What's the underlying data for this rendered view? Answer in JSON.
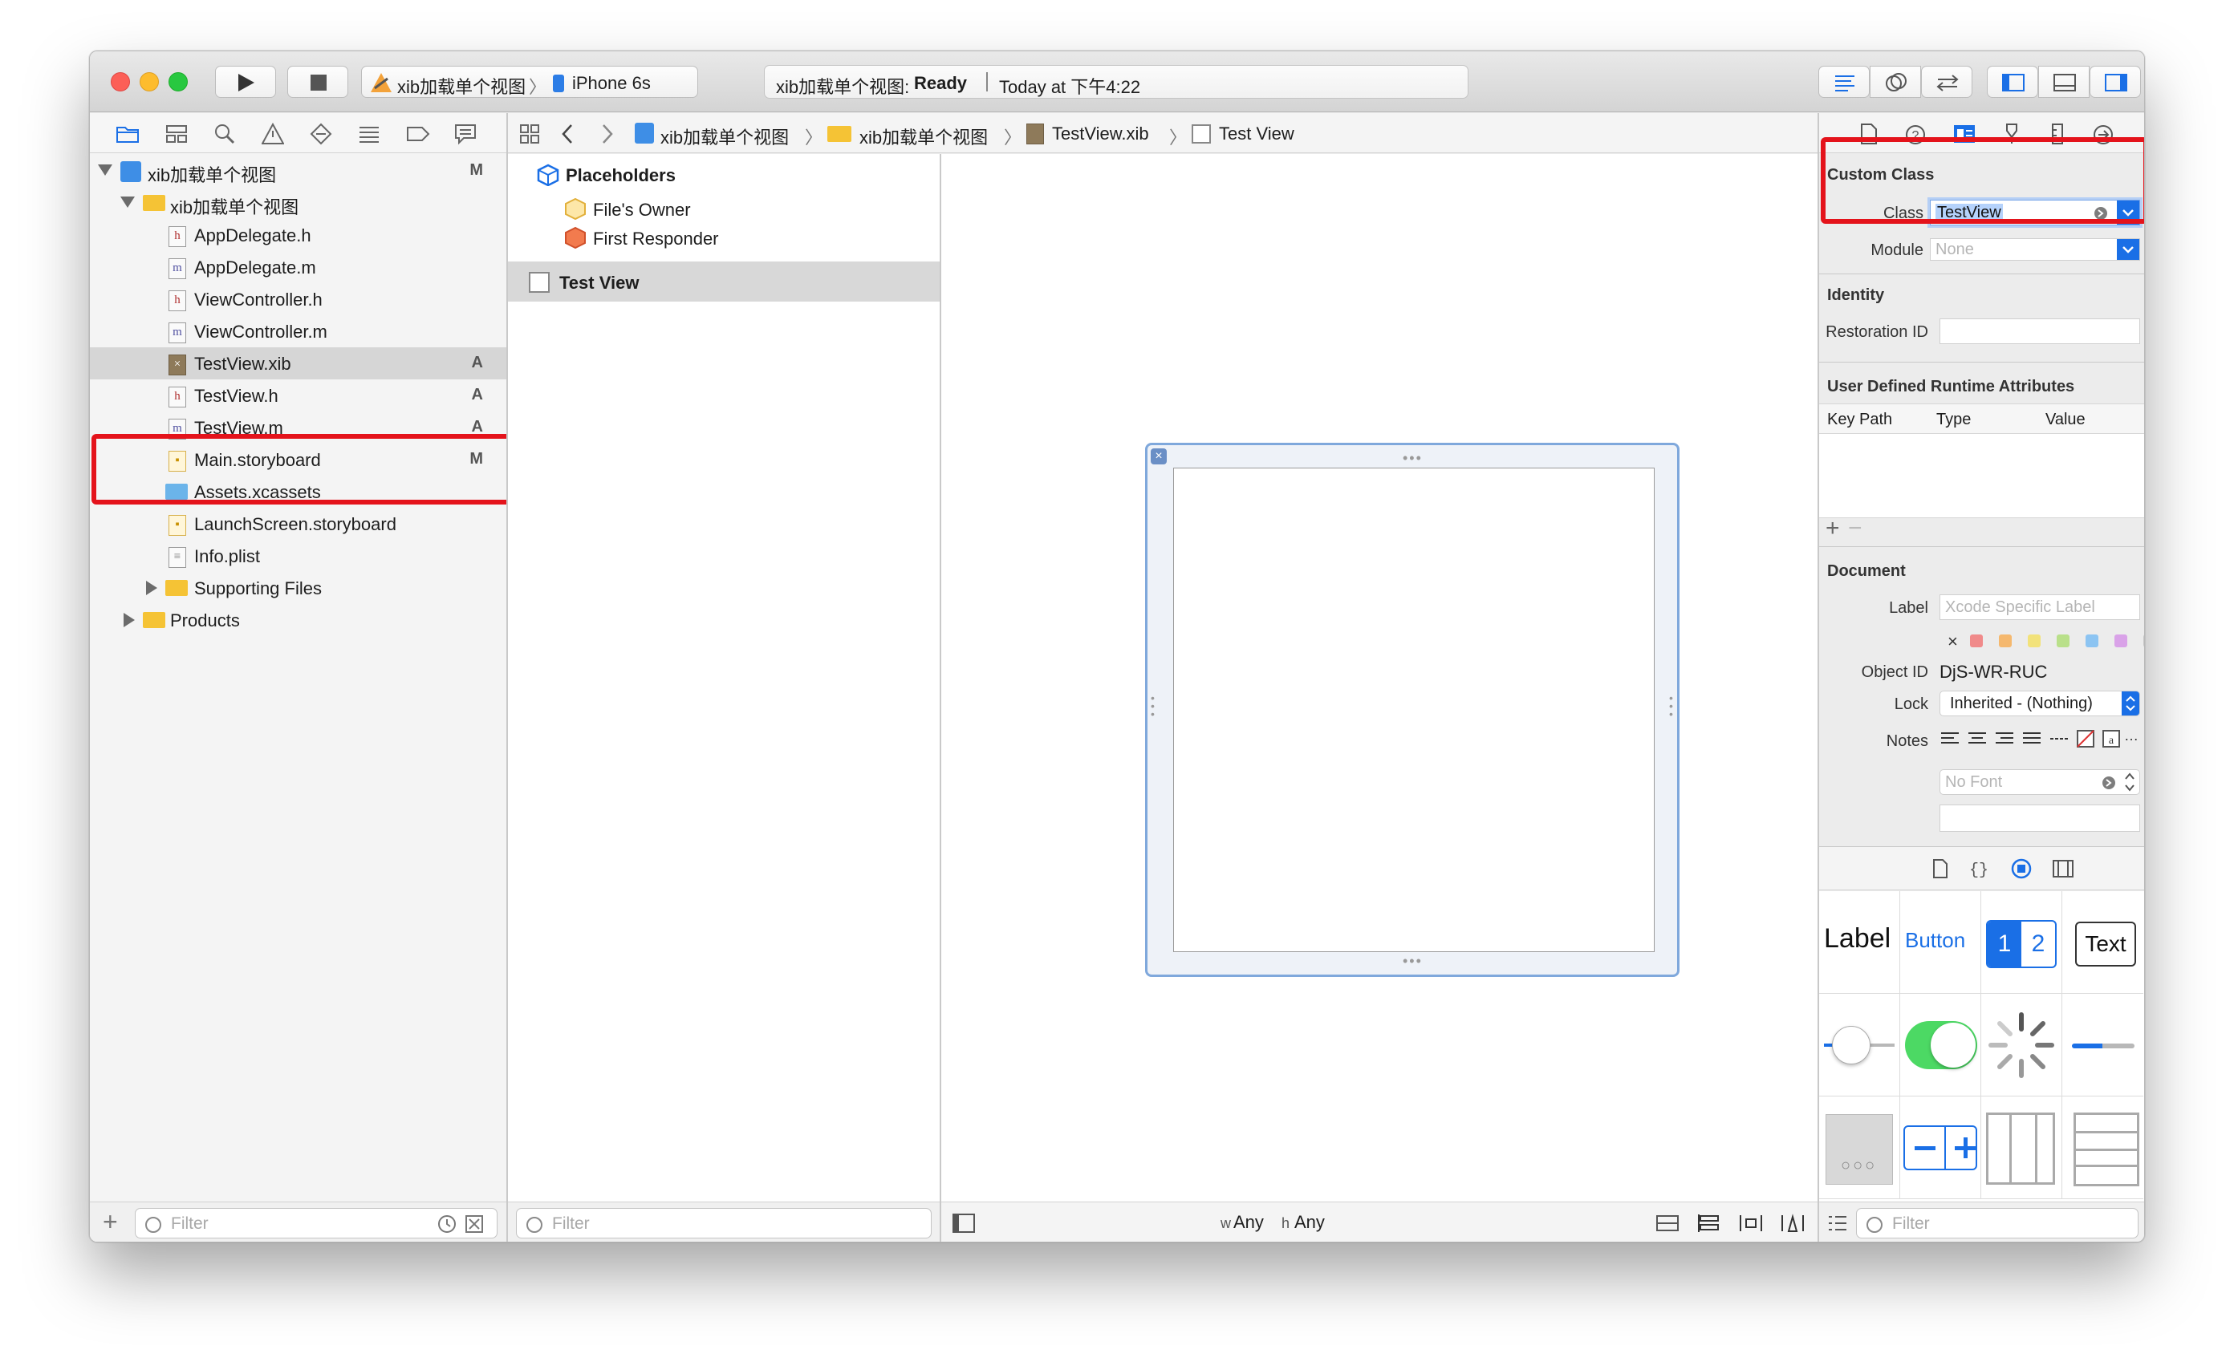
{
  "toolbar": {
    "scheme": "xib加载单个视图",
    "scheme_sep": "〉",
    "device": "iPhone 6s",
    "status_project": "xib加载单个视图:",
    "status_state": "Ready",
    "status_time": "Today at 下午4:22"
  },
  "navigator": {
    "filter_placeholder": "Filter",
    "items": [
      {
        "label": "xib加载单个视图",
        "badge": "M",
        "kind": "project"
      },
      {
        "label": "xib加载单个视图",
        "badge": "",
        "kind": "folder-open"
      },
      {
        "label": "AppDelegate.h",
        "badge": "",
        "kind": "h"
      },
      {
        "label": "AppDelegate.m",
        "badge": "",
        "kind": "m"
      },
      {
        "label": "ViewController.h",
        "badge": "",
        "kind": "h"
      },
      {
        "label": "ViewController.m",
        "badge": "",
        "kind": "m"
      },
      {
        "label": "TestView.xib",
        "badge": "A",
        "kind": "xib",
        "selected": true
      },
      {
        "label": "TestView.h",
        "badge": "A",
        "kind": "h"
      },
      {
        "label": "TestView.m",
        "badge": "A",
        "kind": "m"
      },
      {
        "label": "Main.storyboard",
        "badge": "M",
        "kind": "storyboard"
      },
      {
        "label": "Assets.xcassets",
        "badge": "",
        "kind": "assets"
      },
      {
        "label": "LaunchScreen.storyboard",
        "badge": "",
        "kind": "storyboard"
      },
      {
        "label": "Info.plist",
        "badge": "",
        "kind": "plist"
      },
      {
        "label": "Supporting Files",
        "badge": "",
        "kind": "folder-closed"
      },
      {
        "label": "Products",
        "badge": "",
        "kind": "folder-closed"
      }
    ]
  },
  "jumpbar": {
    "crumbs": [
      "xib加载单个视图",
      "xib加载单个视图",
      "TestView.xib",
      "Test View"
    ],
    "sep": "〉"
  },
  "outline": {
    "placeholders": "Placeholders",
    "files_owner": "File's Owner",
    "first_responder": "First Responder",
    "test_view": "Test View",
    "filter_placeholder": "Filter"
  },
  "canvas": {
    "size_w_prefix": "w",
    "size_w": "Any",
    "size_h_prefix": "h",
    "size_h": "Any"
  },
  "inspector": {
    "custom_class_title": "Custom Class",
    "class_label": "Class",
    "class_value": "TestView",
    "module_label": "Module",
    "module_placeholder": "None",
    "identity_title": "Identity",
    "restoration_label": "Restoration ID",
    "uda_title": "User Defined Runtime Attributes",
    "uda_cols": [
      "Key Path",
      "Type",
      "Value"
    ],
    "document_title": "Document",
    "doc_label_label": "Label",
    "doc_label_placeholder": "Xcode Specific Label",
    "object_id_label": "Object ID",
    "object_id_value": "DjS-WR-RUC",
    "lock_label": "Lock",
    "lock_value": "Inherited - (Nothing)",
    "notes_label": "Notes",
    "font_placeholder": "No Font",
    "swatch_colors": [
      "#f08a8a",
      "#f5b86e",
      "#f2e27a",
      "#b9e08a",
      "#8cc4f2",
      "#d9a2e8",
      "#c8c8c8"
    ]
  },
  "library": {
    "label": "Label",
    "button": "Button",
    "seg1": "1",
    "seg2": "2",
    "text": "Text",
    "filter_placeholder": "Filter"
  },
  "colors": {
    "accent": "#1a6fe6",
    "highlight": "#e4131b",
    "switch": "#4cd964"
  }
}
